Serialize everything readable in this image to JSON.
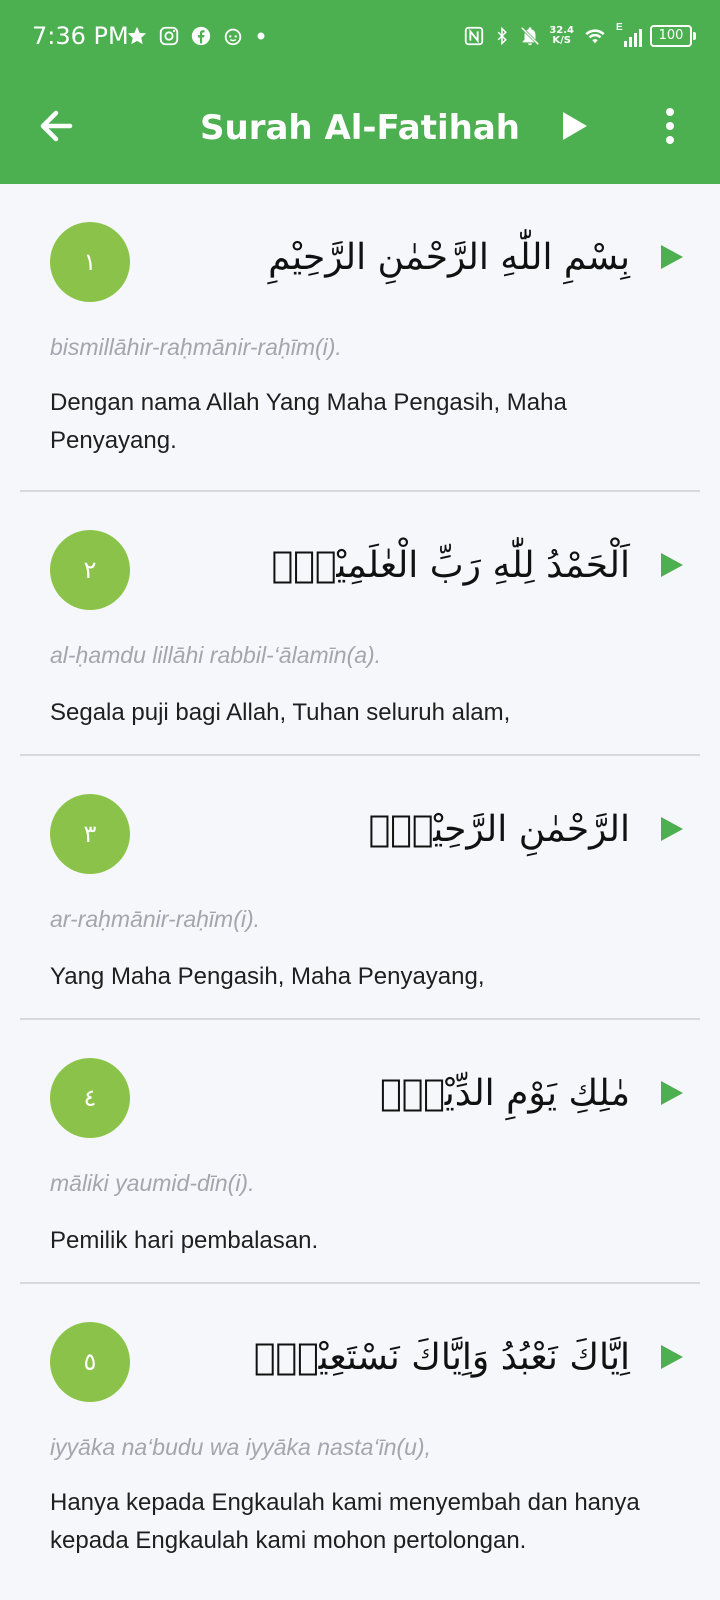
{
  "status_bar": {
    "time": "7:36 PM",
    "net_speed_value": "32.4",
    "net_speed_unit": "K/S",
    "network_type": "E",
    "battery": "100",
    "icons": [
      "star-icon",
      "instagram-icon",
      "facebook-icon",
      "reddit-icon",
      "dot-icon",
      "nfc-icon",
      "bluetooth-icon",
      "mute-icon",
      "wifi-icon",
      "signal-icon",
      "battery-icon"
    ]
  },
  "app_bar": {
    "title": "Surah Al-Fatihah",
    "back_icon": "arrow-left-icon",
    "play_icon": "play-icon",
    "menu_icon": "more-vertical-icon"
  },
  "verses": [
    {
      "number": "١",
      "arabic": "بِسْمِ اللّٰهِ الرَّحْمٰنِ الرَّحِيْمِ",
      "latin": "bismillāhir-raḥmānir-raḥīm(i).",
      "translation": "Dengan nama Allah Yang Maha Pengasih, Maha Penyayang."
    },
    {
      "number": "٢",
      "arabic": "اَلْحَمْدُ لِلّٰهِ رَبِّ الْعٰلَمِيْنَۙ",
      "latin": "al-ḥamdu lillāhi rabbil-‘ālamīn(a).",
      "translation": "Segala puji bagi Allah, Tuhan seluruh alam,"
    },
    {
      "number": "٣",
      "arabic": "الرَّحْمٰنِ الرَّحِيْمِۙ",
      "latin": "ar-raḥmānir-raḥīm(i).",
      "translation": "Yang Maha Pengasih, Maha Penyayang,"
    },
    {
      "number": "٤",
      "arabic": "مٰلِكِ يَوْمِ الدِّيْنِۗ",
      "latin": "māliki yaumid-dīn(i).",
      "translation": "Pemilik hari pembalasan."
    },
    {
      "number": "٥",
      "arabic": "اِيَّاكَ نَعْبُدُ وَاِيَّاكَ نَسْتَعِيْنُۗ",
      "latin": "iyyāka na‘budu wa iyyāka nasta‘īn(u),",
      "translation": "Hanya kepada Engkaulah kami menyembah dan hanya kepada Engkaulah kami mohon pertolongan."
    }
  ],
  "colors": {
    "header": "#4caf50",
    "number_badge": "#8bc34a",
    "play_accent": "#4caf50",
    "background": "#f6f7fb",
    "divider": "#d7d9dd",
    "latin_text": "#a3a6ad",
    "translation_text": "#1f1f1f"
  }
}
